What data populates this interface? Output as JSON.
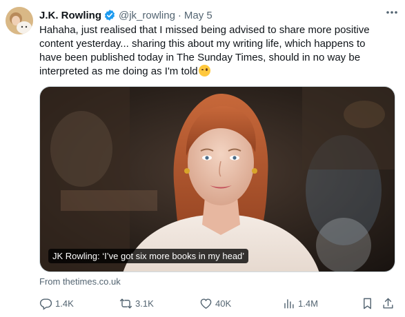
{
  "tweet": {
    "author_name": "J.K. Rowling",
    "handle": "@jk_rowling",
    "separator": "·",
    "date": "May 5",
    "text": "Hahaha, just realised that I missed being advised to share more positive content yesterday... sharing this about my writing life, which happens to have been published today in The Sunday Times, should in no way be interpreted as me doing as I'm told",
    "emoji_icon": "winking-face-icon"
  },
  "card": {
    "caption": "JK Rowling: ‘I’ve got six more books in my head’",
    "source": "From thetimes.co.uk"
  },
  "actions": {
    "replies": "1.4K",
    "reposts": "3.1K",
    "likes": "40K",
    "views": "1.4M"
  },
  "colors": {
    "verified": "#1d9bf0",
    "muted": "#536471",
    "text": "#0f1419"
  }
}
